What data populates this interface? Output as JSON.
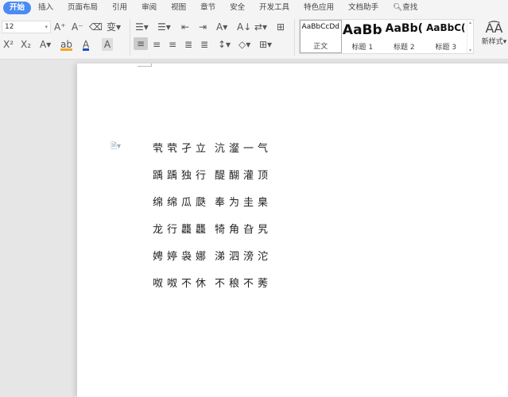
{
  "tabs": [
    "开始",
    "插入",
    "页面布局",
    "引用",
    "审阅",
    "视图",
    "章节",
    "安全",
    "开发工具",
    "特色应用",
    "文档助手",
    "查找"
  ],
  "active_tab": "开始",
  "toolbar": {
    "font_size": "12",
    "styles": [
      {
        "preview": "AaBbCcDd",
        "name": "正文"
      },
      {
        "preview": "AaBb",
        "name": "标题 1"
      },
      {
        "preview": "AaBb(",
        "name": "标题 2"
      },
      {
        "preview": "AaBbC(",
        "name": "标题 3"
      }
    ],
    "new_style": "新样式"
  },
  "document": {
    "lines": [
      [
        "茕茕孑立",
        "沆瀣一气"
      ],
      [
        "踽踽独行",
        "醍醐灌顶"
      ],
      [
        "绵绵瓜瓞",
        "奉为圭臬"
      ],
      [
        "龙行龘龘",
        "犄角旮旯"
      ],
      [
        "娉婷袅娜",
        "涕泗滂沱"
      ],
      [
        "呶呶不休",
        "不稂不莠"
      ]
    ]
  }
}
